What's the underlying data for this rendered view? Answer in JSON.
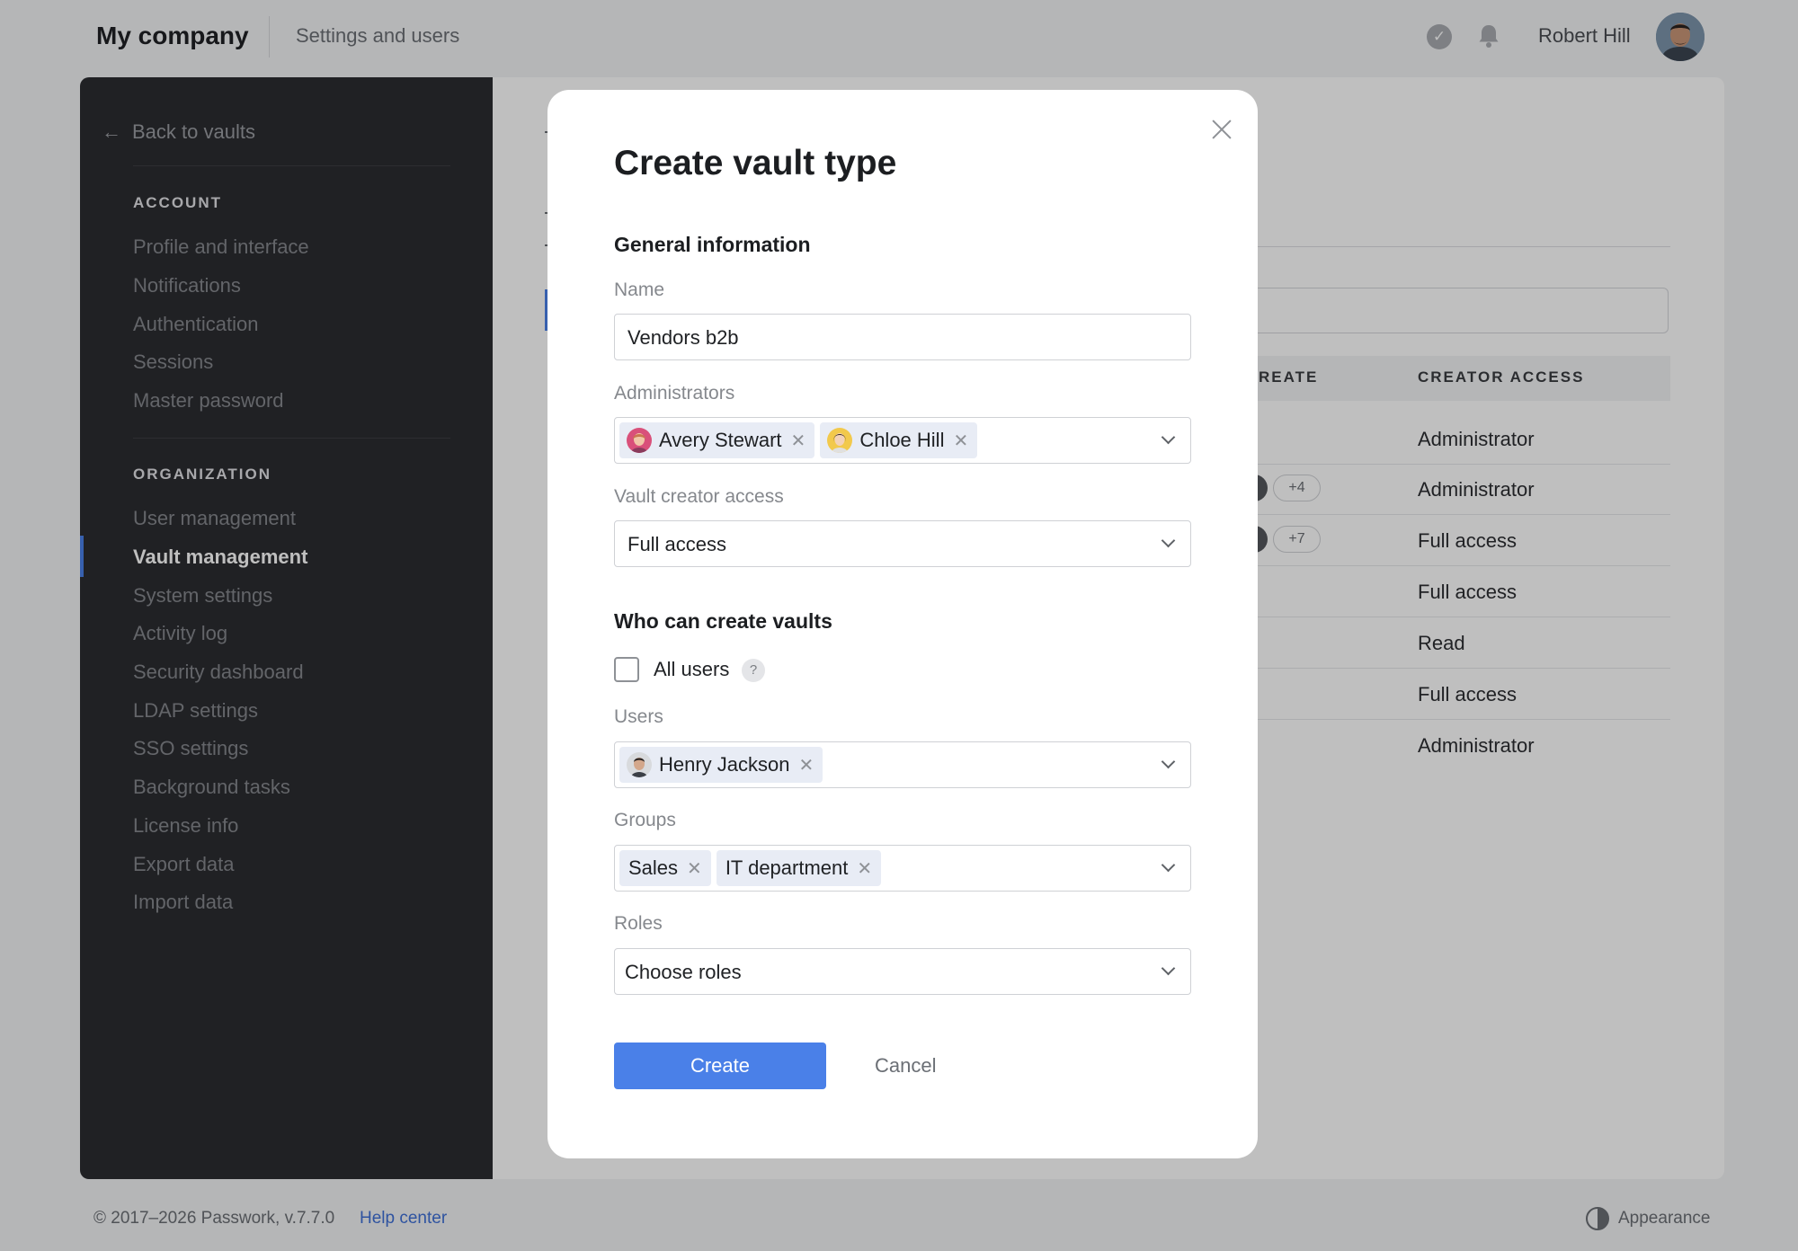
{
  "header": {
    "brand": "My company",
    "section": "Settings and users",
    "user_name": "Robert Hill"
  },
  "sidebar": {
    "back_label": "Back to vaults",
    "account_heading": "ACCOUNT",
    "account_items": [
      "Profile and interface",
      "Notifications",
      "Authentication",
      "Sessions",
      "Master password"
    ],
    "organization_heading": "ORGANIZATION",
    "organization_items": [
      "User management",
      "Vault management",
      "System settings",
      "Activity log",
      "Security dashboard",
      "LDAP settings",
      "SSO settings",
      "Background tasks",
      "License info",
      "Export data",
      "Import data"
    ],
    "active_item": "Vault management"
  },
  "table": {
    "col_create_partial": "REATE",
    "col_creator_access": "CREATOR ACCESS",
    "rows": [
      {
        "more": "",
        "access": "Administrator"
      },
      {
        "more": "+4",
        "access": "Administrator"
      },
      {
        "more": "+7",
        "access": "Full access"
      },
      {
        "more": "",
        "access": "Full access"
      },
      {
        "more": "",
        "access": "Read"
      },
      {
        "more": "",
        "access": "Full access"
      },
      {
        "more": "",
        "access": "Administrator"
      }
    ]
  },
  "modal": {
    "title": "Create vault type",
    "general_section": "General information",
    "name_label": "Name",
    "name_value": "Vendors b2b",
    "admins_label": "Administrators",
    "admins": [
      "Avery Stewart",
      "Chloe Hill"
    ],
    "creator_access_label": "Vault creator access",
    "creator_access_value": "Full access",
    "who_section": "Who can create vaults",
    "all_users_label": "All users",
    "help_glyph": "?",
    "users_label": "Users",
    "users": [
      "Henry Jackson"
    ],
    "groups_label": "Groups",
    "groups": [
      "Sales",
      "IT department"
    ],
    "roles_label": "Roles",
    "roles_placeholder": "Choose roles",
    "create_button": "Create",
    "cancel_button": "Cancel"
  },
  "footer": {
    "copyright": "© 2017–2026 Passwork, v.7.7.0",
    "help_link": "Help center",
    "appearance": "Appearance"
  },
  "icons": {
    "top_status": "check-circle-icon",
    "top_notifications": "bell-icon",
    "back": "arrow-left-icon",
    "close": "close-icon",
    "dropdown": "chevron-down-icon",
    "chip_remove": "x-icon",
    "help": "question-icon",
    "appearance": "contrast-icon"
  },
  "colors": {
    "accent": "#4a80e8",
    "sidebar_bg": "#2b2c30",
    "chip_bg": "#e8ecf5"
  }
}
